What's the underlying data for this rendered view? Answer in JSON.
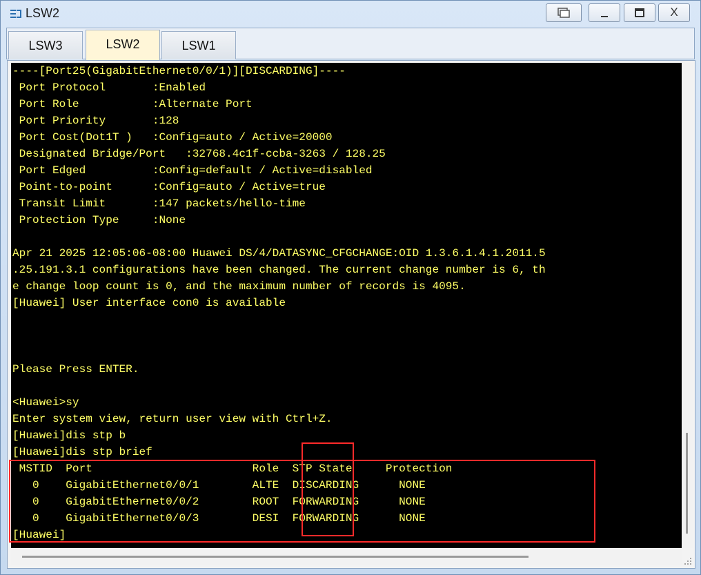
{
  "window": {
    "title": "LSW2",
    "app_icon": "switch-icon",
    "buttons": [
      "restore-icon",
      "minimize-icon",
      "maximize-icon",
      "close-icon"
    ],
    "close_label": "X"
  },
  "tabs": [
    {
      "label": "LSW3",
      "active": false
    },
    {
      "label": "LSW2",
      "active": true
    },
    {
      "label": "LSW1",
      "active": false
    }
  ],
  "colors": {
    "terminal_bg": "#000000",
    "terminal_text": "#ffff66",
    "highlight": "#ff2a2a"
  },
  "terminal": {
    "lines": [
      "----[Port25(GigabitEthernet0/0/1)][DISCARDING]----",
      " Port Protocol       :Enabled",
      " Port Role           :Alternate Port",
      " Port Priority       :128",
      " Port Cost(Dot1T )   :Config=auto / Active=20000",
      " Designated Bridge/Port   :32768.4c1f-ccba-3263 / 128.25",
      " Port Edged          :Config=default / Active=disabled",
      " Point-to-point      :Config=auto / Active=true",
      " Transit Limit       :147 packets/hello-time",
      " Protection Type     :None",
      "",
      "Apr 21 2025 12:05:06-08:00 Huawei DS/4/DATASYNC_CFGCHANGE:OID 1.3.6.1.4.1.2011.5",
      ".25.191.3.1 configurations have been changed. The current change number is 6, th",
      "e change loop count is 0, and the maximum number of records is 4095.",
      "[Huawei] User interface con0 is available",
      "",
      "",
      "",
      "Please Press ENTER.",
      "",
      "<Huawei>sy",
      "Enter system view, return user view with Ctrl+Z.",
      "[Huawei]dis stp b",
      "[Huawei]dis stp brief",
      " MSTID  Port                        Role  STP State     Protection",
      "   0    GigabitEthernet0/0/1        ALTE  DISCARDING      NONE",
      "   0    GigabitEthernet0/0/2        ROOT  FORWARDING      NONE",
      "   0    GigabitEthernet0/0/3        DESI  FORWARDING      NONE",
      "[Huawei]"
    ]
  }
}
